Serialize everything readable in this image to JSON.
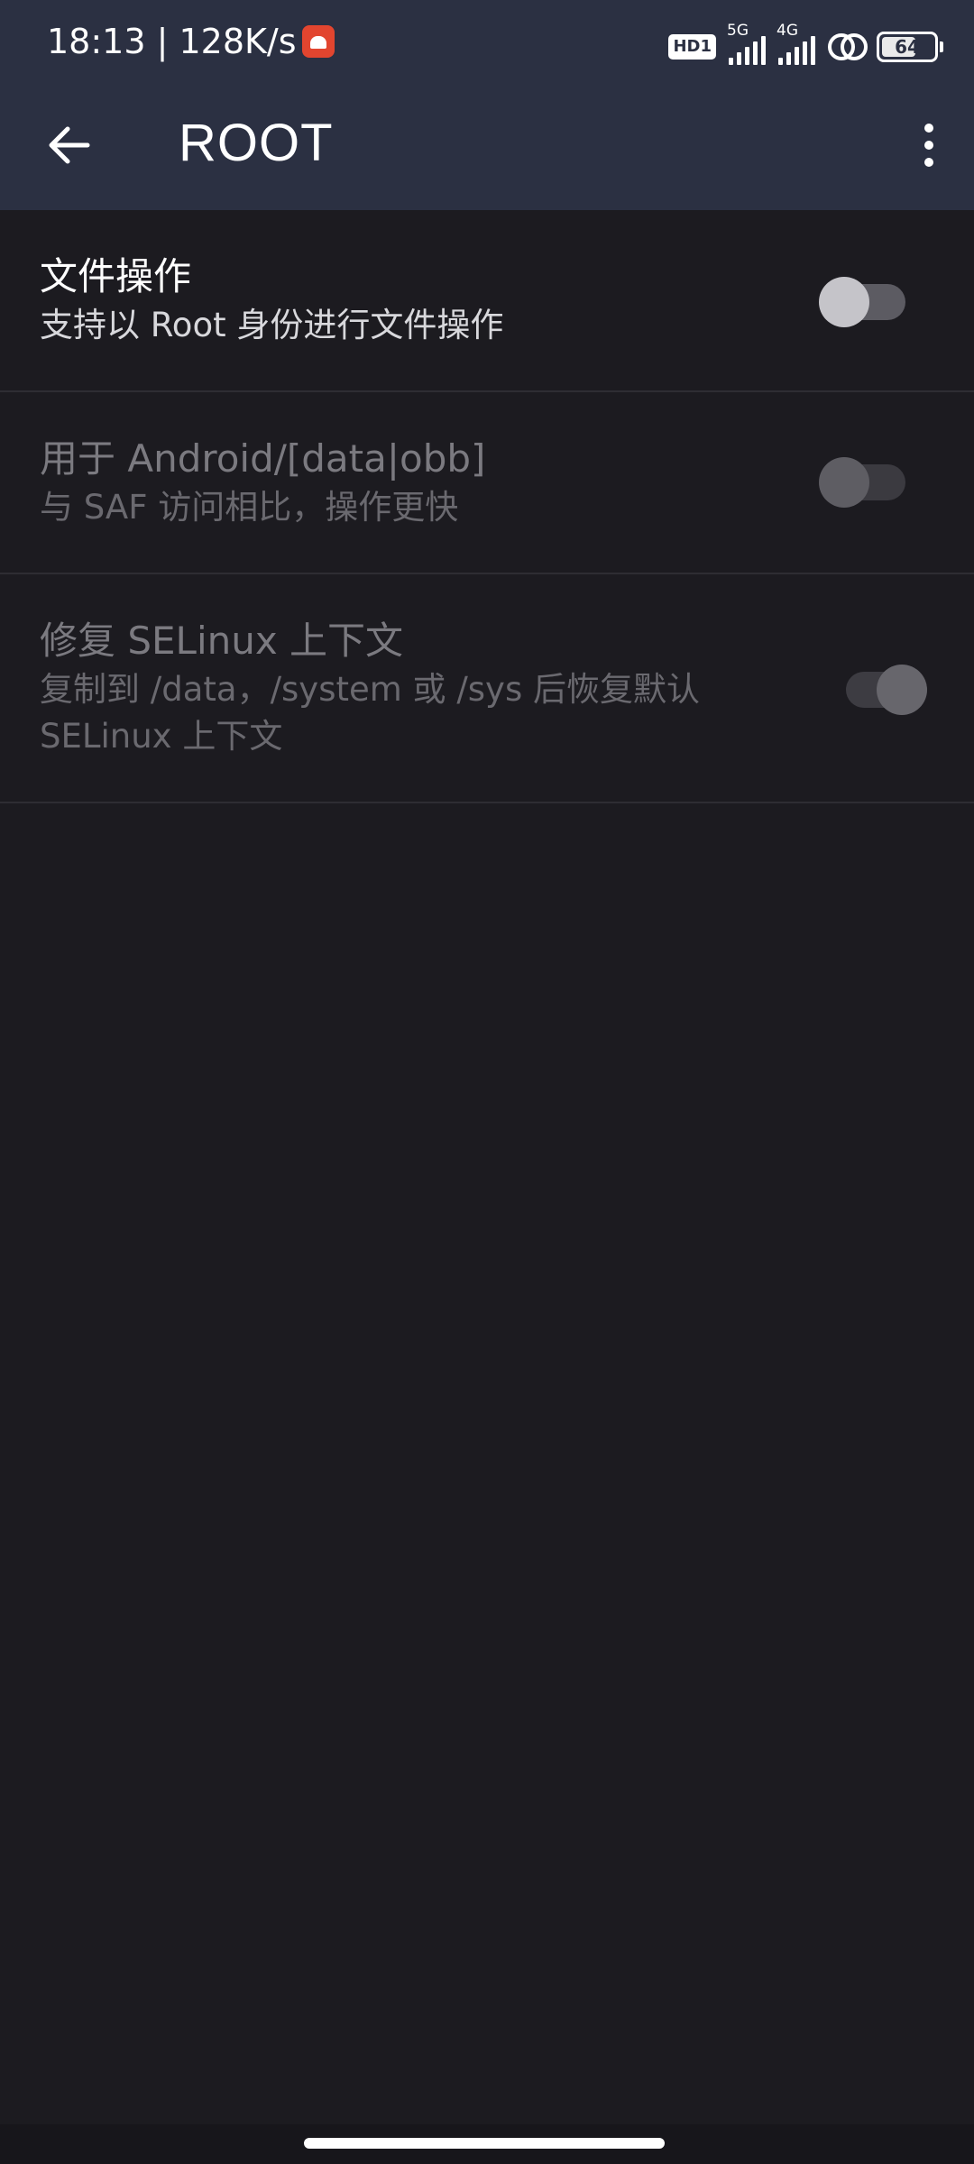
{
  "status_bar": {
    "time": "18:13",
    "separator": " | ",
    "net_speed": "128K/s",
    "hd_label": "HD1",
    "signal1_label": "5G",
    "signal2_label": "4G",
    "battery_level": "64"
  },
  "app_bar": {
    "title": "ROOT"
  },
  "settings": [
    {
      "title": "文件操作",
      "summary": "支持以 Root 身份进行文件操作",
      "enabled": true,
      "checked": false
    },
    {
      "title": "用于 Android/[data|obb]",
      "summary": "与 SAF 访问相比，操作更快",
      "enabled": false,
      "checked": false
    },
    {
      "title": "修复 SELinux 上下文",
      "summary_line1": "复制到 /data，/system 或 /sys 后恢复默认",
      "summary_line2": "SELinux 上下文",
      "enabled": false,
      "checked": true
    }
  ],
  "colors": {
    "app_bar": "#2b3042",
    "background": "#1c1b20"
  }
}
